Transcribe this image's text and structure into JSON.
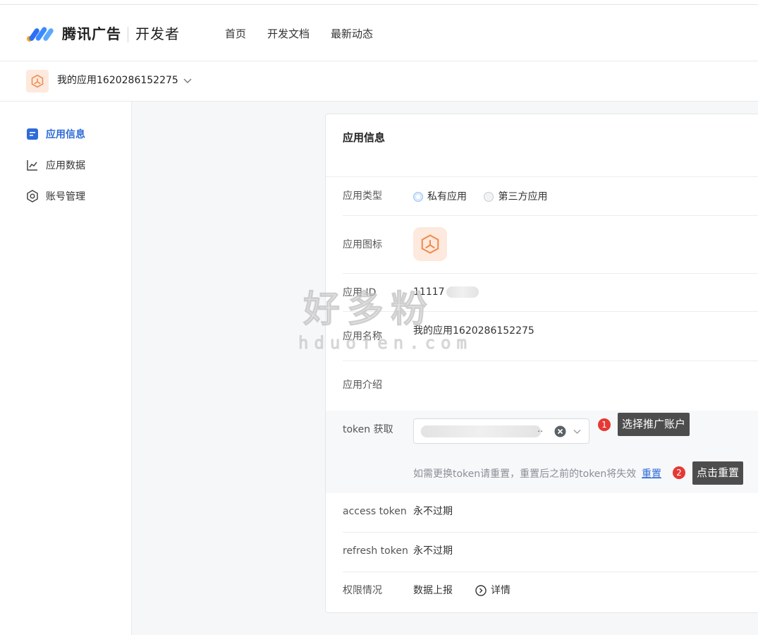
{
  "header": {
    "brand": "腾讯广告",
    "brand_sub": "开发者",
    "nav": [
      "首页",
      "开发文档",
      "最新动态"
    ]
  },
  "app_selector": {
    "name": "我的应用1620286152275"
  },
  "sidebar": {
    "items": [
      {
        "label": "应用信息",
        "icon": "document-icon",
        "active": true
      },
      {
        "label": "应用数据",
        "icon": "line-chart-icon",
        "active": false
      },
      {
        "label": "账号管理",
        "icon": "hexagon-settings-icon",
        "active": false
      }
    ]
  },
  "card": {
    "title": "应用信息",
    "rows": {
      "type": {
        "label": "应用类型",
        "options": [
          "私有应用",
          "第三方应用"
        ],
        "selected": "私有应用"
      },
      "icon": {
        "label": "应用图标"
      },
      "id": {
        "label": "应用 ID",
        "value": "11117"
      },
      "name": {
        "label": "应用名称",
        "value": "我的应用1620286152275"
      },
      "intro": {
        "label": "应用介绍",
        "value": ""
      },
      "token": {
        "label": "token 获取",
        "select_suffix": "..",
        "hint": "如需更换token请重置，重置后之前的token将失效",
        "reset_label": "重置"
      },
      "access": {
        "label": "access token",
        "value": "永不过期"
      },
      "refresh": {
        "label": "refresh token",
        "value": "永不过期"
      },
      "permission": {
        "label": "权限情况",
        "value": "数据上报",
        "detail_label": "详情"
      }
    }
  },
  "annotations": [
    {
      "number": "1",
      "text": "选择推广账户"
    },
    {
      "number": "2",
      "text": "点击重置"
    }
  ],
  "watermark": {
    "line1": "好多粉",
    "line2": "hduofen.com"
  },
  "colors": {
    "accent": "#2f6bd9",
    "app_icon_bg": "#fde9dd",
    "app_icon_fg": "#f08a4b",
    "badge": "#e53935"
  }
}
